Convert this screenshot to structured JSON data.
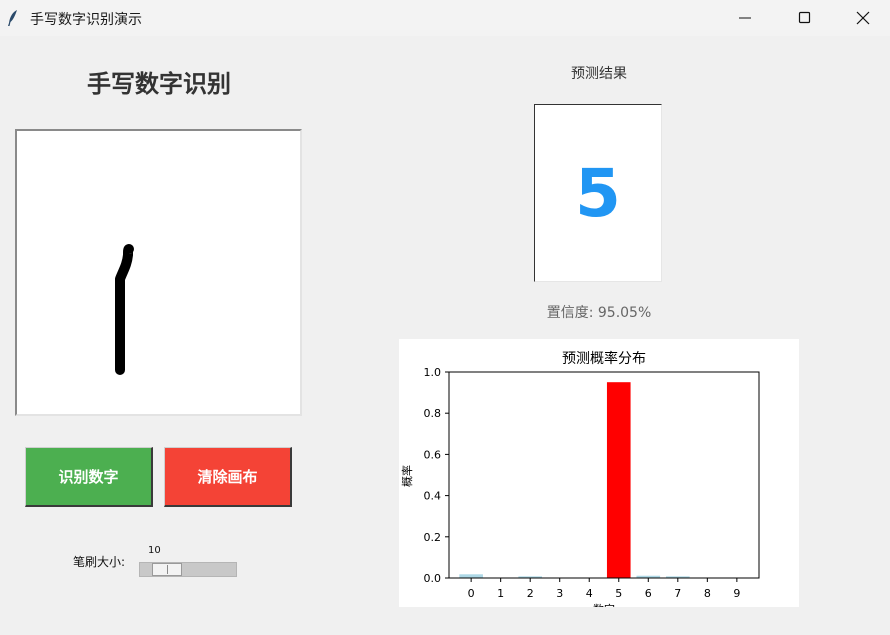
{
  "window": {
    "title": "手写数字识别演示"
  },
  "app": {
    "heading": "手写数字识别"
  },
  "buttons": {
    "recognize_label": "识别数字",
    "clear_label": "清除画布"
  },
  "brush": {
    "label": "笔刷大小:",
    "value": "10",
    "min": 1,
    "max": 50,
    "level": 10
  },
  "result": {
    "label": "预测结果",
    "digit": "5",
    "confidence_text": "置信度: 95.05%"
  },
  "colors": {
    "recognize_button": "#4caf50",
    "clear_button": "#f44336",
    "result_digit": "#2196f3",
    "highlight_bar": "#ff0000",
    "other_bars": "#add8e6"
  },
  "chart_data": {
    "type": "bar",
    "title": "预测概率分布",
    "xlabel": "数字",
    "ylabel": "概率",
    "categories": [
      "0",
      "1",
      "2",
      "3",
      "4",
      "5",
      "6",
      "7",
      "8",
      "9"
    ],
    "values": [
      0.018,
      0.002,
      0.008,
      0.002,
      0.002,
      0.9505,
      0.011,
      0.008,
      0.002,
      0.002
    ],
    "ylim": [
      0,
      1.0
    ],
    "yticks": [
      "0.0",
      "0.2",
      "0.4",
      "0.6",
      "0.8",
      "1.0"
    ],
    "highlight_index": 5,
    "grid": false
  }
}
